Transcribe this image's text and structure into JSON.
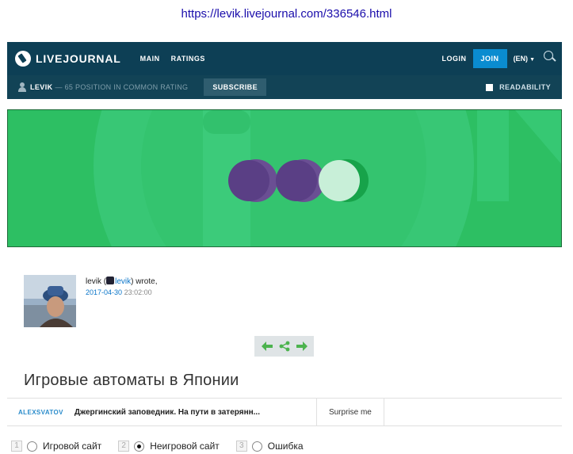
{
  "url": "https://levik.livejournal.com/336546.html",
  "header": {
    "logo_text": "LIVEJOURNAL",
    "nav": [
      "MAIN",
      "RATINGS"
    ],
    "login": "LOGIN",
    "join": "JOIN",
    "lang": "(EN)"
  },
  "subheader": {
    "user": "LEVIK",
    "rating": "— 65 POSITION IN COMMON RATING",
    "subscribe": "SUBSCRIBE",
    "readability": "READABILITY"
  },
  "post": {
    "author_prefix": "levik (",
    "author_user": "levik",
    "author_suffix": ") wrote,",
    "date": "2017-04-30",
    "time": "23:02:00",
    "title": "Игровые автоматы в Японии"
  },
  "related": {
    "author": "ALEXSVATOV",
    "text": "Джергинский заповедник. На пути в затерянн...",
    "link": "Surprise me"
  },
  "options": [
    {
      "num": "1",
      "label": "Игровой сайт",
      "selected": false
    },
    {
      "num": "2",
      "label": "Неигровой сайт",
      "selected": true
    },
    {
      "num": "3",
      "label": "Ошибка",
      "selected": false
    }
  ],
  "colors": {
    "nav_bg": "#0d3f55",
    "subnav_bg": "#124356",
    "join_bg": "#0a8cd0",
    "banner_green": "#2dbf63",
    "link_blue": "#0a75c9"
  }
}
